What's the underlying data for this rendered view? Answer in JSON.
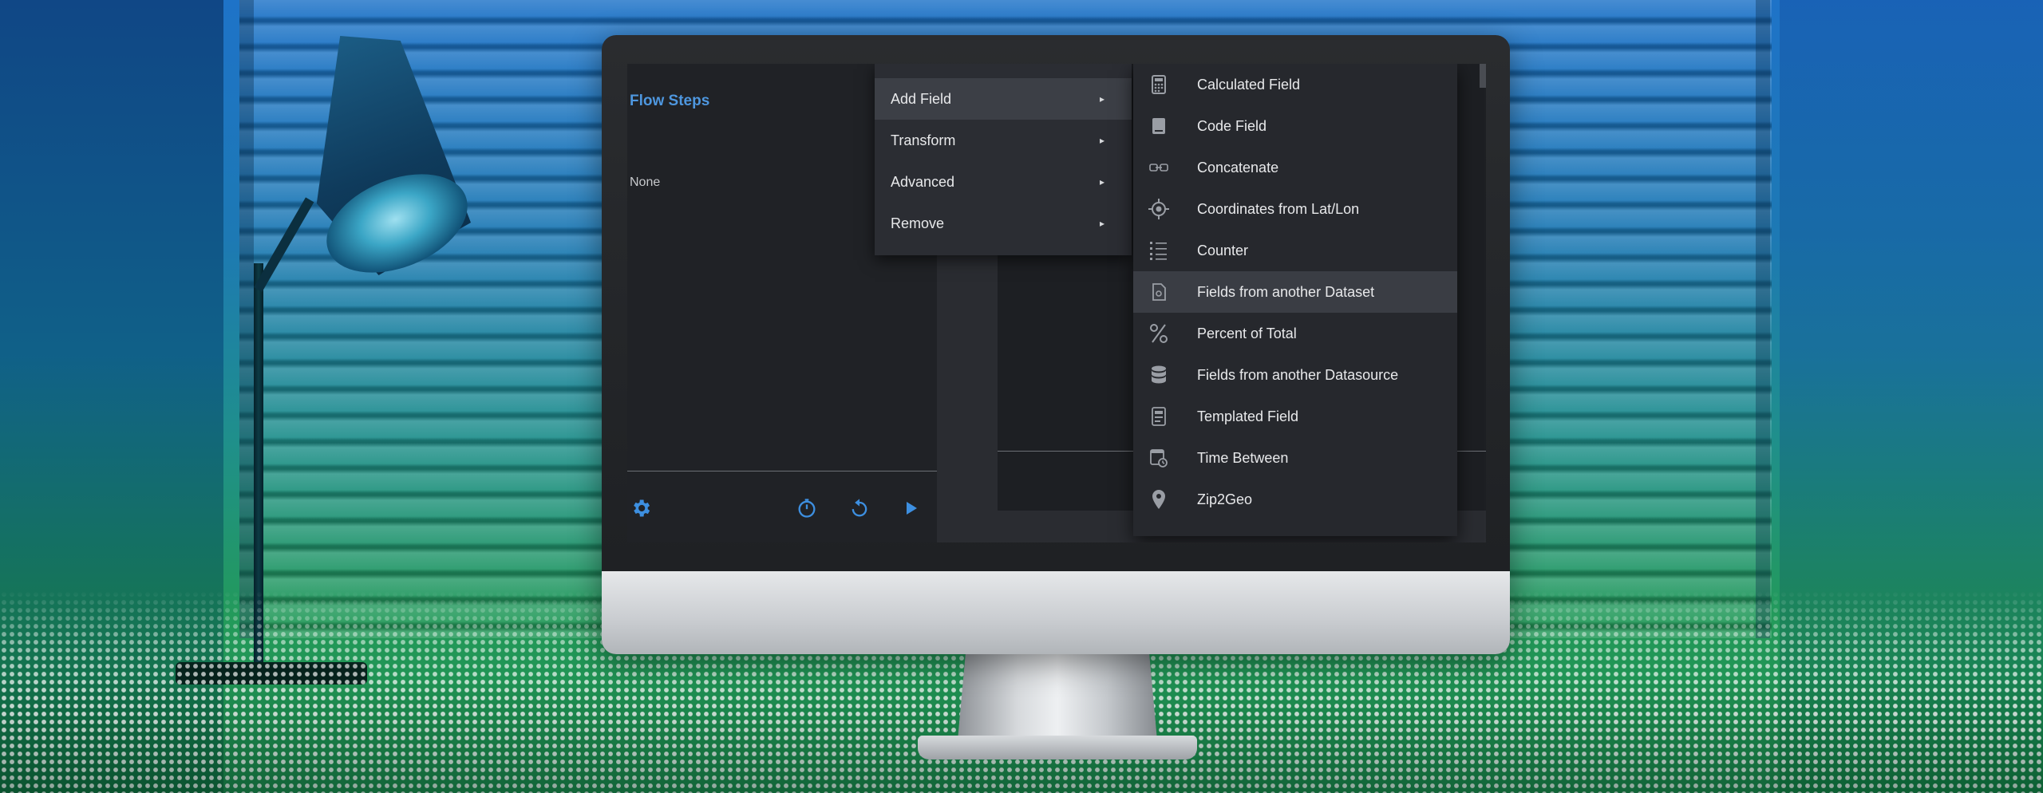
{
  "left_panel": {
    "title": "Flow Steps",
    "empty_text": "None"
  },
  "menu": [
    {
      "label": "Add Field",
      "arrow": "▸"
    },
    {
      "label": "Transform",
      "arrow": "▸"
    },
    {
      "label": "Advanced",
      "arrow": "▸"
    },
    {
      "label": "Remove",
      "arrow": "▸"
    }
  ],
  "submenu": [
    {
      "label": "Calculated Field",
      "icon": "calculator-icon"
    },
    {
      "label": "Code Field",
      "icon": "code-book-icon"
    },
    {
      "label": "Concatenate",
      "icon": "link-icon"
    },
    {
      "label": "Coordinates from Lat/Lon",
      "icon": "crosshair-icon"
    },
    {
      "label": "Counter",
      "icon": "numbered-list-icon"
    },
    {
      "label": "Fields from another Dataset",
      "icon": "dataset-file-icon"
    },
    {
      "label": "Percent of Total",
      "icon": "percent-icon"
    },
    {
      "label": "Fields from another Datasource",
      "icon": "database-icon"
    },
    {
      "label": "Templated Field",
      "icon": "template-icon"
    },
    {
      "label": "Time Between",
      "icon": "calendar-clock-icon"
    },
    {
      "label": "Zip2Geo",
      "icon": "map-pin-icon"
    }
  ],
  "toolbar_icons": [
    "gear-icon",
    "timer-icon",
    "reset-icon",
    "play-icon"
  ],
  "colors": {
    "accent": "#4e97df",
    "menu_bg": "#2b2d33",
    "submenu_bg": "#26282d",
    "hover_bg": "#3a3d44"
  }
}
